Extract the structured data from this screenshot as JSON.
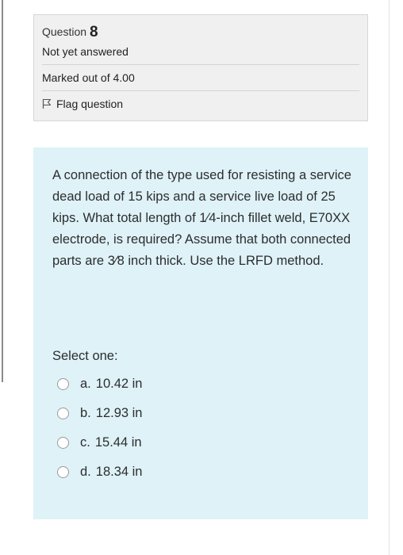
{
  "question": {
    "title_label": "Question",
    "number": "8",
    "status": "Not yet answered",
    "marks": "Marked out of 4.00",
    "flag_label": "Flag question",
    "flag_icon": "flag-outline-icon"
  },
  "content": {
    "text": "A connection of the type used for resisting a service dead load of 15 kips and a service live load of 25 kips. What total length of 1⁄4-inch fillet weld, E70XX electrode, is required? Assume that both connected parts are 3⁄8 inch thick. Use the LRFD method.",
    "prompt": "Select one:",
    "options": [
      {
        "letter": "a.",
        "text": "10.42 in"
      },
      {
        "letter": "b.",
        "text": "12.93 in"
      },
      {
        "letter": "c.",
        "text": "15.44 in"
      },
      {
        "letter": "d.",
        "text": "18.34 in"
      }
    ]
  },
  "colors": {
    "info_background": "#f0f0f1",
    "question_background": "#def2f8"
  }
}
